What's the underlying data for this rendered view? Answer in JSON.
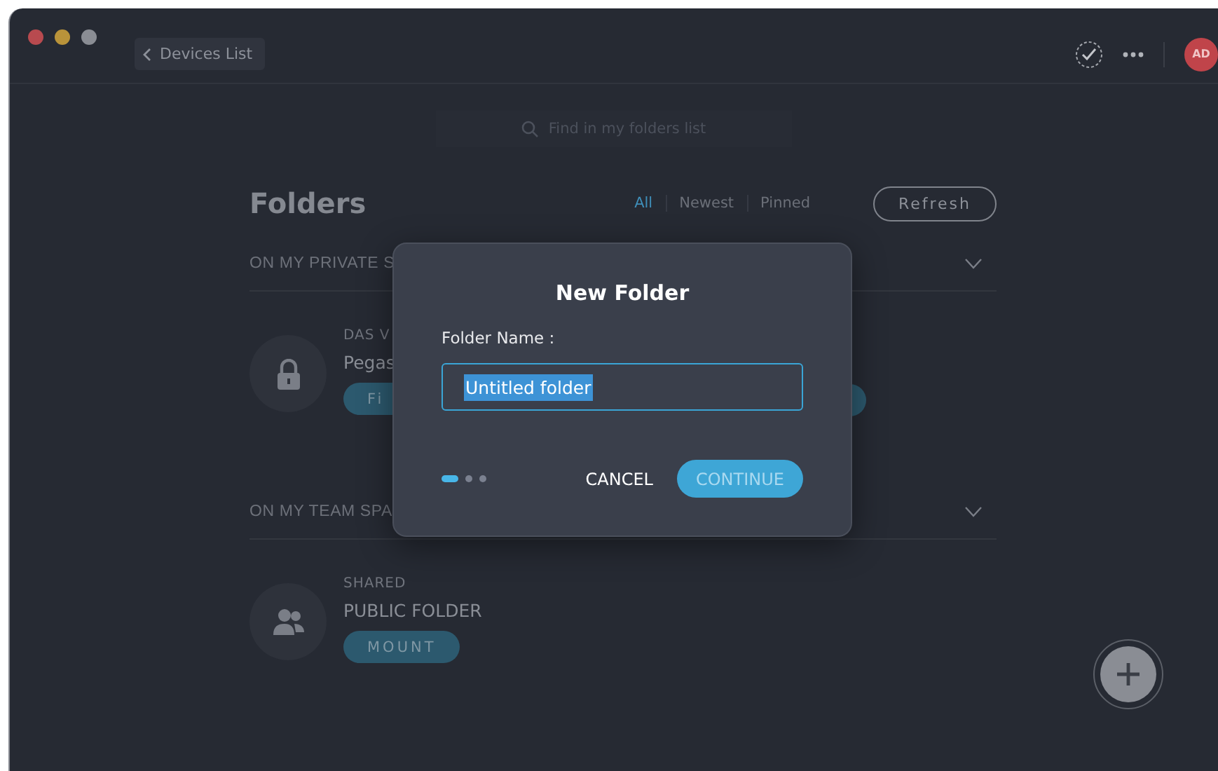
{
  "toolbar": {
    "back_button": "Devices List",
    "avatar": "AD"
  },
  "search": {
    "placeholder": "Find in my folders list"
  },
  "header": {
    "title": "Folders",
    "filters": [
      {
        "label": "All",
        "selected": true
      },
      {
        "label": "Newest",
        "selected": false
      },
      {
        "label": "Pinned",
        "selected": false
      }
    ],
    "refresh_button": "Refresh"
  },
  "sections": [
    {
      "title": "ON MY PRIVATE S",
      "items": [
        {
          "kind": "lock",
          "type": "DAS V",
          "name": "Pegas",
          "button": "Fi"
        }
      ]
    },
    {
      "title": "ON MY TEAM SPA",
      "items": [
        {
          "kind": "team",
          "type": "SHARED",
          "name": "PUBLIC FOLDER",
          "button": "MOUNT"
        }
      ]
    }
  ],
  "dialog": {
    "title": "New Folder",
    "label": "Folder Name :",
    "value": "Untitled folder",
    "steps": [
      {
        "selected": true
      },
      {
        "selected": false
      },
      {
        "selected": false
      }
    ],
    "cancel": "CANCEL",
    "continue": "CONTINUE"
  }
}
